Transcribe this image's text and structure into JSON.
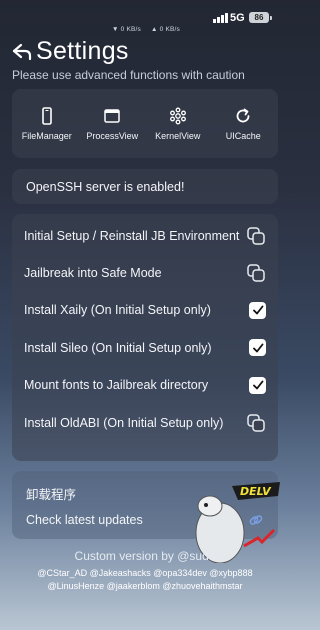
{
  "status_bar": {
    "net_speed_up": "▼ 0 KB/s",
    "net_speed_down": "▲ 0 KB/s",
    "network": "5G",
    "battery": "86"
  },
  "header": {
    "title": "Settings",
    "subtitle": "Please use advanced functions with caution"
  },
  "tools": [
    {
      "label": "FileManager",
      "icon": "phone-icon"
    },
    {
      "label": "ProcessView",
      "icon": "window-icon"
    },
    {
      "label": "KernelView",
      "icon": "kernel-icon"
    },
    {
      "label": "UICache",
      "icon": "refresh-icon"
    }
  ],
  "notice": "OpenSSH server is enabled!",
  "options": [
    {
      "label": "Initial Setup / Reinstall JB Environment",
      "control": "copy-icon"
    },
    {
      "label": "Jailbreak into Safe Mode",
      "control": "copy-icon"
    },
    {
      "label": "Install Xaily (On Initial Setup only)",
      "control": "checkbox",
      "checked": true
    },
    {
      "label": "Install Sileo (On Initial Setup only)",
      "control": "checkbox",
      "checked": true
    },
    {
      "label": "Mount fonts to Jailbreak directory",
      "control": "checkbox",
      "checked": true
    },
    {
      "label": "Install OldABI (On Initial Setup only)",
      "control": "copy-icon"
    }
  ],
  "bottom": {
    "uninstall": "卸载程序",
    "check_updates": "Check latest updates"
  },
  "credits": {
    "title": "Custom version by @sudo",
    "line1": "@CStar_AD @Jakeashacks @opa334dev @xybp888",
    "line2": "@LinusHenze @jaakerblom @zhuovehaithmstar"
  },
  "colors": {
    "card": "#3c4250",
    "text": "#ffffff",
    "sticker_text": "#f2e23a",
    "sticker_accent": "#d9262c"
  }
}
